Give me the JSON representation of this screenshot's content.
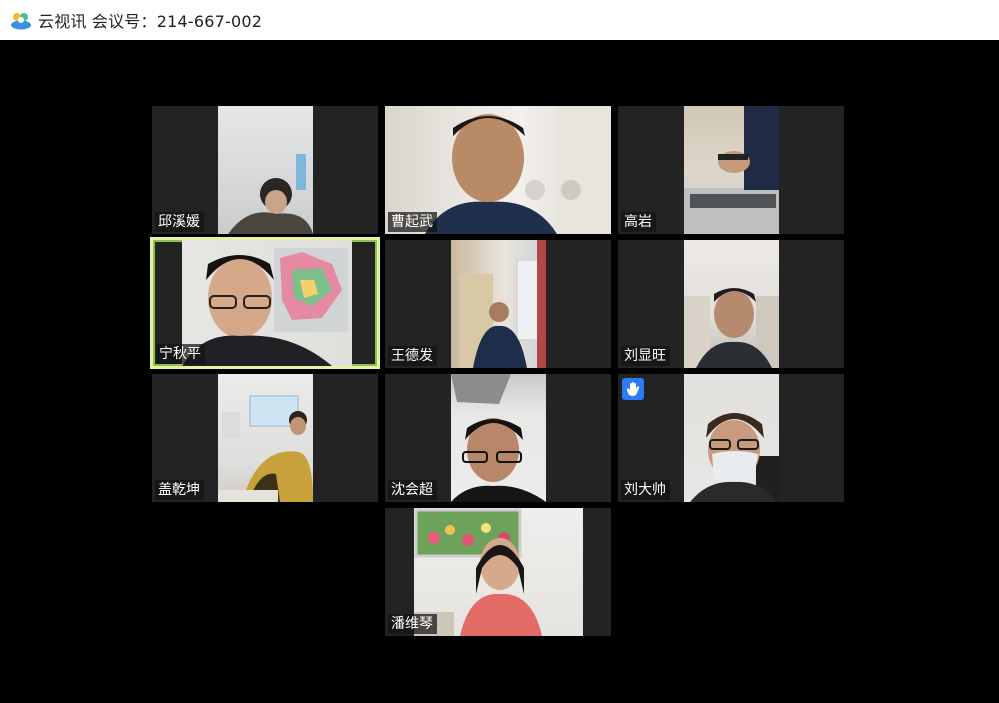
{
  "window": {
    "app_name": "云视讯",
    "meeting_label": "会议号：",
    "meeting_id": "214-667-002",
    "logo_icon": "cloud-video-logo-icon"
  },
  "participants": [
    {
      "name": "邱溪媛",
      "active": false,
      "hand_raised": false
    },
    {
      "name": "曹起武",
      "active": false,
      "hand_raised": false
    },
    {
      "name": "高岩",
      "active": false,
      "hand_raised": false
    },
    {
      "name": "宁秋平",
      "active": true,
      "hand_raised": false
    },
    {
      "name": "王德发",
      "active": false,
      "hand_raised": false
    },
    {
      "name": "刘显旺",
      "active": false,
      "hand_raised": false
    },
    {
      "name": "盖乾坤",
      "active": false,
      "hand_raised": false
    },
    {
      "name": "沈会超",
      "active": false,
      "hand_raised": false
    },
    {
      "name": "刘大帅",
      "active": false,
      "hand_raised": true
    },
    {
      "name": "潘维琴",
      "active": false,
      "hand_raised": false
    }
  ],
  "colors": {
    "stage_bg": "#000000",
    "tile_bg": "#232323",
    "active_border": "#e8f0a3",
    "raise_hand_bg": "#2d7cf6"
  }
}
